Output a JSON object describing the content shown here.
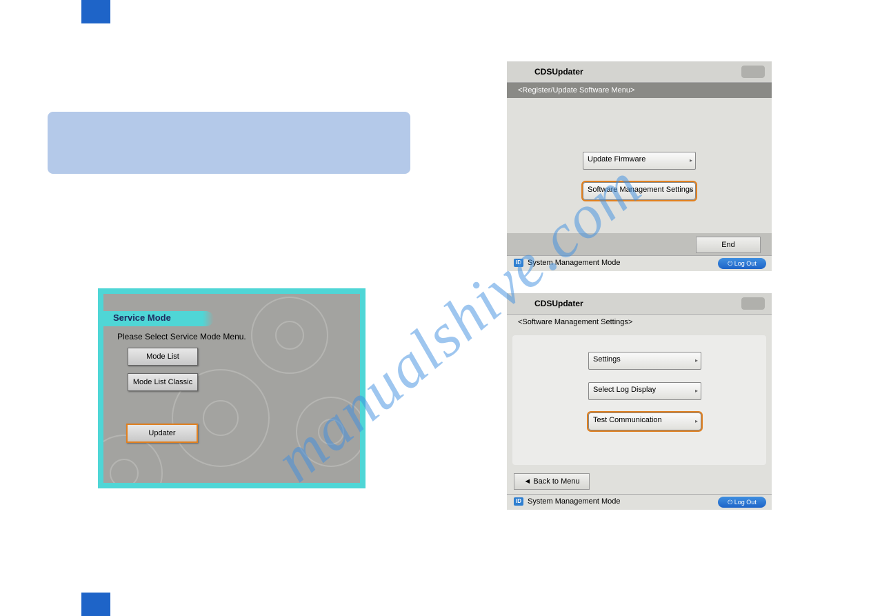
{
  "watermark": "manualshive.com",
  "service_mode": {
    "title": "Service Mode",
    "subtitle": "Please Select Service Mode Menu.",
    "btn_mode_list": "Mode List",
    "btn_mode_list_classic": "Mode List Classic",
    "btn_updater": "Updater"
  },
  "cds1": {
    "title": "CDSUpdater",
    "sub": "<Register/Update Software Menu>",
    "btn_update_firmware": "Update Firmware",
    "btn_software_mgmt": "Software Management Settings",
    "end": "End",
    "id": "ID",
    "foot": "System Management Mode",
    "logout": "⏻ Log Out"
  },
  "cds2": {
    "title": "CDSUpdater",
    "sub": "<Software Management Settings>",
    "btn_settings": "Settings",
    "btn_select_log": "Select Log Display",
    "btn_test_comm": "Test Communication",
    "back": "◄   Back to Menu",
    "id": "ID",
    "foot": "System Management Mode",
    "logout": "⏻ Log Out"
  }
}
